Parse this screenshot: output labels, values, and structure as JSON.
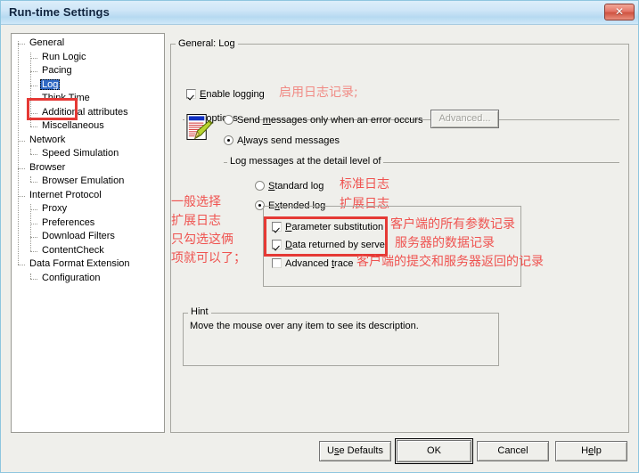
{
  "window": {
    "title": "Run-time Settings",
    "close_label": "✕"
  },
  "tree": {
    "items": [
      {
        "label": "General",
        "indent": 0,
        "selected": false
      },
      {
        "label": "Run Logic",
        "indent": 1,
        "selected": false
      },
      {
        "label": "Pacing",
        "indent": 1,
        "selected": false
      },
      {
        "label": "Log",
        "indent": 1,
        "selected": true
      },
      {
        "label": "Think Time",
        "indent": 1,
        "selected": false
      },
      {
        "label": "Additional attributes",
        "indent": 1,
        "selected": false
      },
      {
        "label": "Miscellaneous",
        "indent": 1,
        "selected": false
      },
      {
        "label": "Network",
        "indent": 0,
        "selected": false
      },
      {
        "label": "Speed Simulation",
        "indent": 1,
        "selected": false
      },
      {
        "label": "Browser",
        "indent": 0,
        "selected": false
      },
      {
        "label": "Browser Emulation",
        "indent": 1,
        "selected": false
      },
      {
        "label": "Internet Protocol",
        "indent": 0,
        "selected": false
      },
      {
        "label": "Proxy",
        "indent": 1,
        "selected": false
      },
      {
        "label": "Preferences",
        "indent": 1,
        "selected": false
      },
      {
        "label": "Download Filters",
        "indent": 1,
        "selected": false
      },
      {
        "label": "ContentCheck",
        "indent": 1,
        "selected": false
      },
      {
        "label": "Data Format Extension",
        "indent": 0,
        "selected": false
      },
      {
        "label": "Configuration",
        "indent": 1,
        "selected": false
      }
    ]
  },
  "main": {
    "group_title": "General: Log",
    "enable_logging": {
      "label": "Enable logging",
      "label_prefix": "",
      "label_underlined": "E",
      "label_rest": "nable logging",
      "checked": true
    },
    "log_options": {
      "legend": "Log options",
      "radio_error_only": {
        "label_a": "Send ",
        "label_u": "m",
        "label_b": "essages only when an error occurs",
        "selected": false
      },
      "radio_always": {
        "label_a": "A",
        "label_u": "l",
        "label_b": "ways send messages",
        "selected": true
      },
      "advanced_button": {
        "label": "Advanced...",
        "enabled": false
      }
    },
    "detail_level": {
      "legend": "Log messages at the detail level of",
      "radio_standard": {
        "label_a": "",
        "label_u": "S",
        "label_b": "tandard log",
        "selected": false
      },
      "radio_extended": {
        "label_a": "E",
        "label_u": "x",
        "label_b": "tended log",
        "selected": true
      },
      "checkboxes": [
        {
          "label_a": "",
          "label_u": "P",
          "label_b": "arameter substitution",
          "checked": true
        },
        {
          "label_a": "",
          "label_u": "D",
          "label_b": "ata returned by server",
          "checked": true
        },
        {
          "label_a": "Advanced ",
          "label_u": "t",
          "label_b": "race",
          "checked": false
        }
      ]
    },
    "hint": {
      "legend": "Hint",
      "text": "Move the mouse over any item to see its description."
    }
  },
  "annotations": {
    "enable_logging": "启用日志记录;",
    "standard_log": "标准日志",
    "extended_log": "扩展日志",
    "left_line1": "一般选择",
    "left_line2": "扩展日志",
    "left_line3": "只勾选这俩",
    "left_line4": "项就可以了；",
    "param_substitution": "客户端的所有参数记录",
    "data_returned": "服务器的数据记录",
    "advanced_trace": "客户端的提交和服务器返回的记录"
  },
  "footer": {
    "buttons": [
      {
        "name": "use-defaults",
        "label_a": "U",
        "label_u": "s",
        "label_b": "e Defaults",
        "default": false
      },
      {
        "name": "ok",
        "label_a": "OK",
        "label_u": "",
        "label_b": "",
        "default": true
      },
      {
        "name": "cancel",
        "label_a": "Cancel",
        "label_u": "",
        "label_b": "",
        "default": false
      },
      {
        "name": "help",
        "label_a": "H",
        "label_u": "e",
        "label_b": "lp",
        "default": false
      }
    ]
  },
  "colors": {
    "accent_red": "#e53935",
    "annotation_red": "#ef5350",
    "selection_blue": "#316ac5",
    "dialog_bg": "#efefeb"
  }
}
